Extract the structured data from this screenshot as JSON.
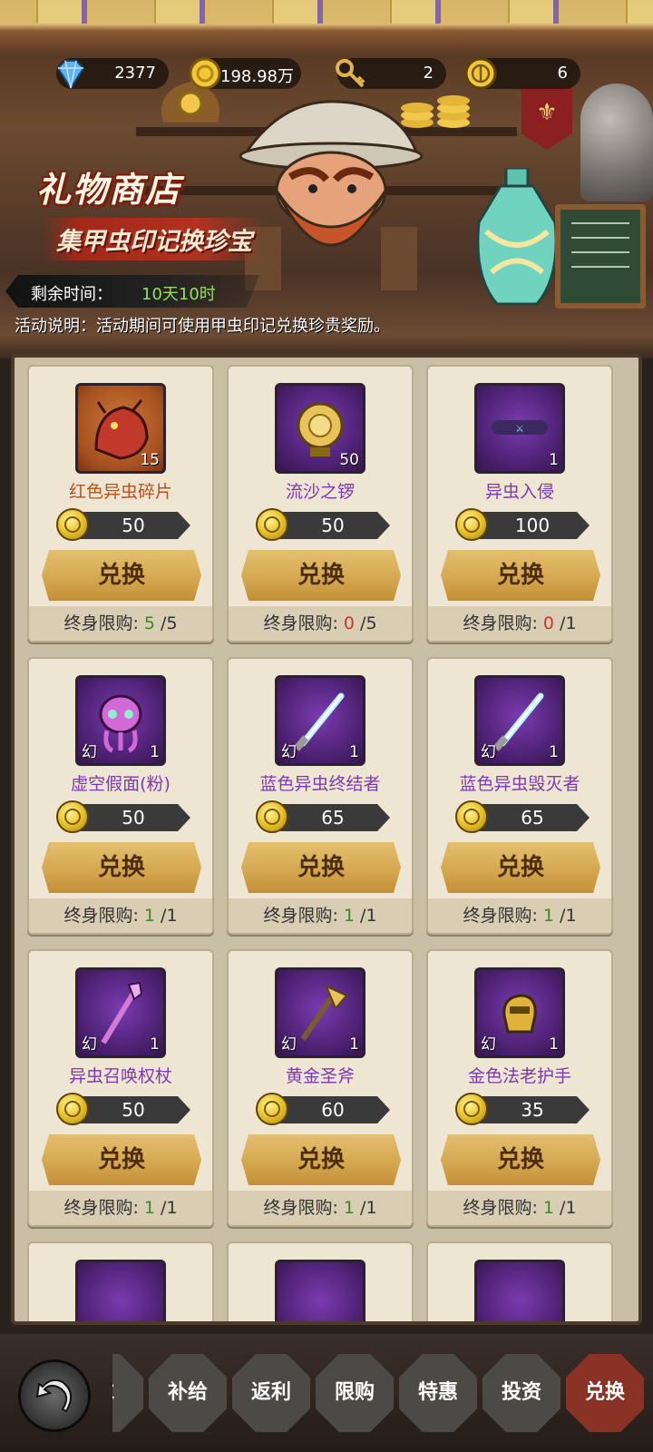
{
  "currencies": [
    {
      "icon": "diamond-icon",
      "value": "2377"
    },
    {
      "icon": "gold-coin-icon",
      "value": "198.98万"
    },
    {
      "icon": "key-icon",
      "value": "2"
    },
    {
      "icon": "beetle-seal-icon",
      "value": "6"
    }
  ],
  "shop": {
    "title": "礼物商店",
    "subtitle": "集甲虫印记换珍宝",
    "timer_label": "剩余时间：",
    "timer_value": "10天10时",
    "description": "活动说明：活动期间可使用甲虫印记兑换珍贵奖励。"
  },
  "common": {
    "exchange_label": "兑换",
    "limit_label": "终身限购:",
    "huan_mark": "幻"
  },
  "items": [
    {
      "name": "红色异虫碎片",
      "qty": "15",
      "price": "50",
      "limit_used": "5",
      "limit_total": "/5",
      "rarity": "orange",
      "icon": "red-bug-fragment-icon"
    },
    {
      "name": "流沙之锣",
      "qty": "50",
      "price": "50",
      "limit_used": "0",
      "limit_total": "/5",
      "rarity": "purple",
      "icon": "gong-icon"
    },
    {
      "name": "异虫入侵",
      "qty": "1",
      "price": "100",
      "limit_used": "0",
      "limit_total": "/1",
      "rarity": "purple",
      "icon": "invasion-icon"
    },
    {
      "name": "虚空假面(粉)",
      "qty": "1",
      "price": "50",
      "limit_used": "1",
      "limit_total": "/1",
      "rarity": "purple",
      "icon": "mask-icon"
    },
    {
      "name": "蓝色异虫终结者",
      "qty": "1",
      "price": "65",
      "limit_used": "1",
      "limit_total": "/1",
      "rarity": "purple",
      "icon": "lightsaber-icon"
    },
    {
      "name": "蓝色异虫毁灭者",
      "qty": "1",
      "price": "65",
      "limit_used": "1",
      "limit_total": "/1",
      "rarity": "purple",
      "icon": "lightsaber-icon"
    },
    {
      "name": "异虫召唤权杖",
      "qty": "1",
      "price": "50",
      "limit_used": "1",
      "limit_total": "/1",
      "rarity": "purple",
      "icon": "scepter-icon"
    },
    {
      "name": "黄金圣斧",
      "qty": "1",
      "price": "60",
      "limit_used": "1",
      "limit_total": "/1",
      "rarity": "purple",
      "icon": "axe-icon"
    },
    {
      "name": "金色法老护手",
      "qty": "1",
      "price": "35",
      "limit_used": "1",
      "limit_total": "/1",
      "rarity": "purple",
      "icon": "gauntlet-icon"
    }
  ],
  "nav": {
    "tabs": [
      "求",
      "补给",
      "返利",
      "限购",
      "特惠",
      "投资",
      "兑换"
    ],
    "active": "兑换"
  },
  "colors": {
    "accent_purple": "#7b3bb0",
    "limit_green": "#3a8a22",
    "limit_red": "#c23a2a",
    "timer_green": "#8fe063",
    "button_gold": "#d4a851"
  }
}
